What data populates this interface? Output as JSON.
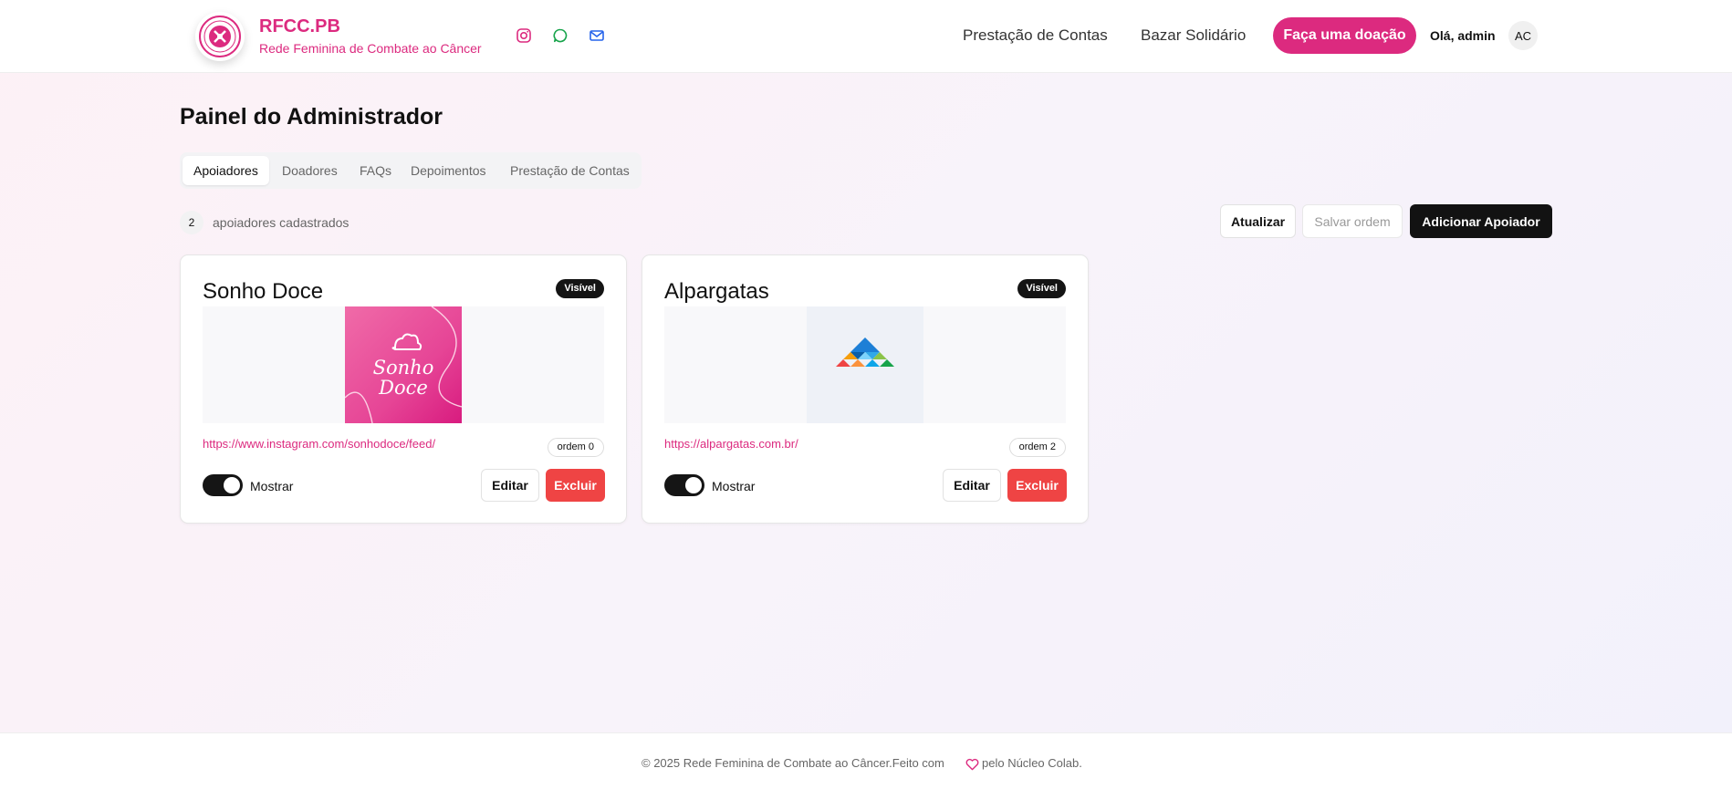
{
  "header": {
    "brand_title": "RFCC.PB",
    "brand_subtitle": "Rede Feminina de Combate ao Câncer",
    "social_icons": [
      "instagram-icon",
      "whatsapp-icon",
      "mail-icon"
    ],
    "nav": [
      "Prestação de Contas",
      "Bazar Solidário"
    ],
    "donate_label": "Faça uma doação",
    "greeting": "Olá, admin",
    "avatar_initials": "AC",
    "brand_color": "#dc2a7f"
  },
  "main": {
    "title": "Painel do Administrador",
    "tabs": [
      "Apoiadores",
      "Doadores",
      "FAQs",
      "Depoimentos",
      "Prestação de Contas"
    ],
    "active_tab": "Apoiadores",
    "count": "2",
    "count_label": "apoiadores cadastrados",
    "actions": {
      "refresh": "Atualizar",
      "save_order": "Salvar ordem",
      "add": "Adicionar Apoiador"
    }
  },
  "supporters": [
    {
      "name": "Sonho Doce",
      "status": "Visível",
      "logo_text_line1": "Sonho",
      "logo_text_line2": "Doce",
      "url": "https://www.instagram.com/sonhodoce/feed/",
      "order": "ordem 0",
      "toggle_label": "Mostrar",
      "edit": "Editar",
      "delete": "Excluir"
    },
    {
      "name": "Alpargatas",
      "status": "Visível",
      "url": "https://alpargatas.com.br/",
      "order": "ordem 2",
      "toggle_label": "Mostrar",
      "edit": "Editar",
      "delete": "Excluir"
    }
  ],
  "footer": {
    "text": "© 2025 Rede Feminina de Combate ao Câncer.Feito com",
    "tail": "pelo Núcleo Colab."
  }
}
